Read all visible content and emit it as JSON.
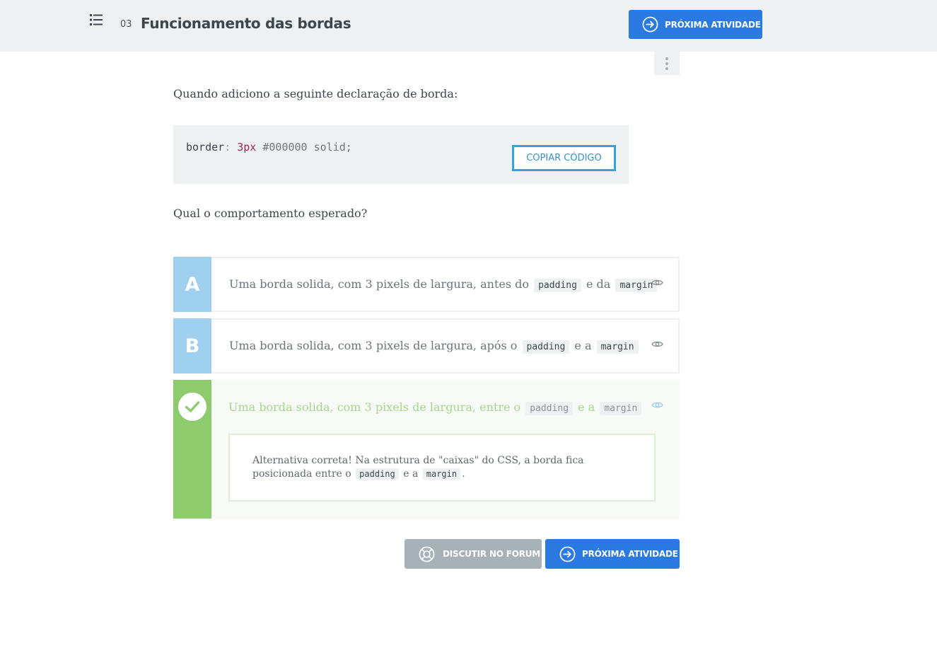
{
  "header": {
    "lesson_number": "03",
    "lesson_title": "Funcionamento das bordas",
    "next_button_label": "PRÓXIMA ATIVIDADE"
  },
  "question": {
    "prompt": "Quando adiciono a seguinte declaração de borda:",
    "code": {
      "property": "border",
      "colon": ":",
      "number": "3px",
      "rest": "#000000 solid;",
      "copy_label": "COPIAR CÓDIGO"
    },
    "ask": "Qual o comportamento esperado?"
  },
  "alternatives": [
    {
      "letter": "A",
      "text_before": "Uma borda solida, com 3 pixels de largura, antes do",
      "code1": "padding",
      "text_mid": "e da",
      "code2": "margin"
    },
    {
      "letter": "B",
      "text_before": "Uma borda solida, com 3 pixels de largura, após o",
      "code1": "padding",
      "text_mid": "e a",
      "code2": "margin"
    },
    {
      "letter": "",
      "text_before": "Uma borda solida, com 3 pixels de largura, entre o",
      "code1": "padding",
      "text_mid": "e a",
      "code2": "margin",
      "correct": true,
      "feedback": {
        "text_before": "Alternativa correta! Na estrutura de \"caixas\" do CSS, a borda fica posicionada entre o",
        "code1": "padding",
        "text_mid": "e a",
        "code2": "margin",
        "text_after": "."
      }
    }
  ],
  "footer": {
    "forum_label": "DISCUTIR NO FORUM",
    "next_label": "PRÓXIMA ATIVIDADE"
  },
  "colors": {
    "primary": "#2a7ae2",
    "correct": "#8dcb6d",
    "option_letter": "#9fd0ef",
    "forum_button": "#a6b2b8",
    "copy_border": "#3aa0d8"
  },
  "icons": {
    "menu": "list-icon",
    "next": "arrow-circle-right-icon",
    "kebab": "more-vertical-icon",
    "reveal": "eye-icon",
    "correct": "check-icon",
    "forum": "lifebuoy-icon"
  }
}
